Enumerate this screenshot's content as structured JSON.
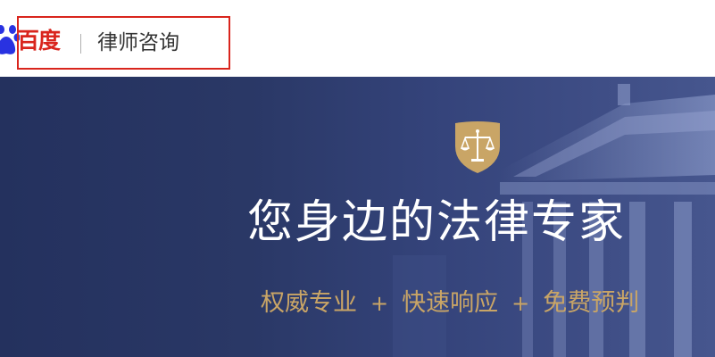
{
  "header": {
    "brand": "百度",
    "product": "律师咨询",
    "icons": {
      "paw": "baidu-paw-icon"
    },
    "colors": {
      "brand_red": "#d9251d",
      "paw_blue": "#2932e1"
    }
  },
  "banner": {
    "headline": "您身边的法律专家",
    "tagline": {
      "item1": "权威专业",
      "sep1": "+",
      "item2": "快速响应",
      "sep2": "+",
      "item3": "免费预判"
    },
    "icons": {
      "shield": "shield-scales-icon"
    },
    "colors": {
      "gold": "#c9a566",
      "background": "#2a3866"
    }
  }
}
